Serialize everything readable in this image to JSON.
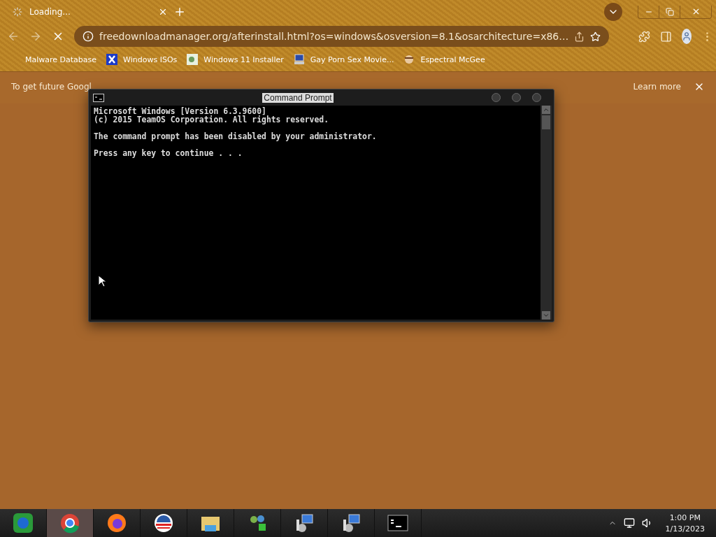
{
  "tab": {
    "title": "Loading...",
    "loading": true
  },
  "toolbar": {
    "url": "freedownloadmanager.org/afterinstall.html?os=windows&osversion=8.1&osarchitecture=x86…"
  },
  "bookmarks": [
    {
      "label": "Malware Database"
    },
    {
      "label": "Windows ISOs"
    },
    {
      "label": "Windows 11 Installer"
    },
    {
      "label": "Gay Porn Sex Movie..."
    },
    {
      "label": "Espectral McGee"
    }
  ],
  "infobar": {
    "text": "To get future Googl",
    "link": "Learn more"
  },
  "console": {
    "title": "Command Prompt",
    "paragraphs": [
      [
        "Microsoft Windows [Version 6.3.9600]",
        "(c) 2015 TeamOS Corporation. All rights reserved."
      ],
      [
        "The command prompt has been disabled by your administrator."
      ],
      [
        "Press any key to continue . . ."
      ]
    ]
  },
  "taskbar": [
    {
      "selected": false
    },
    {
      "selected": true
    },
    {
      "selected": false
    },
    {
      "selected": false
    },
    {
      "selected": false
    },
    {
      "selected": false
    },
    {
      "selected": false
    },
    {
      "selected": false
    },
    {
      "selected": false
    }
  ],
  "clock": {
    "time": "1:00 PM",
    "date": "1/13/2023"
  }
}
